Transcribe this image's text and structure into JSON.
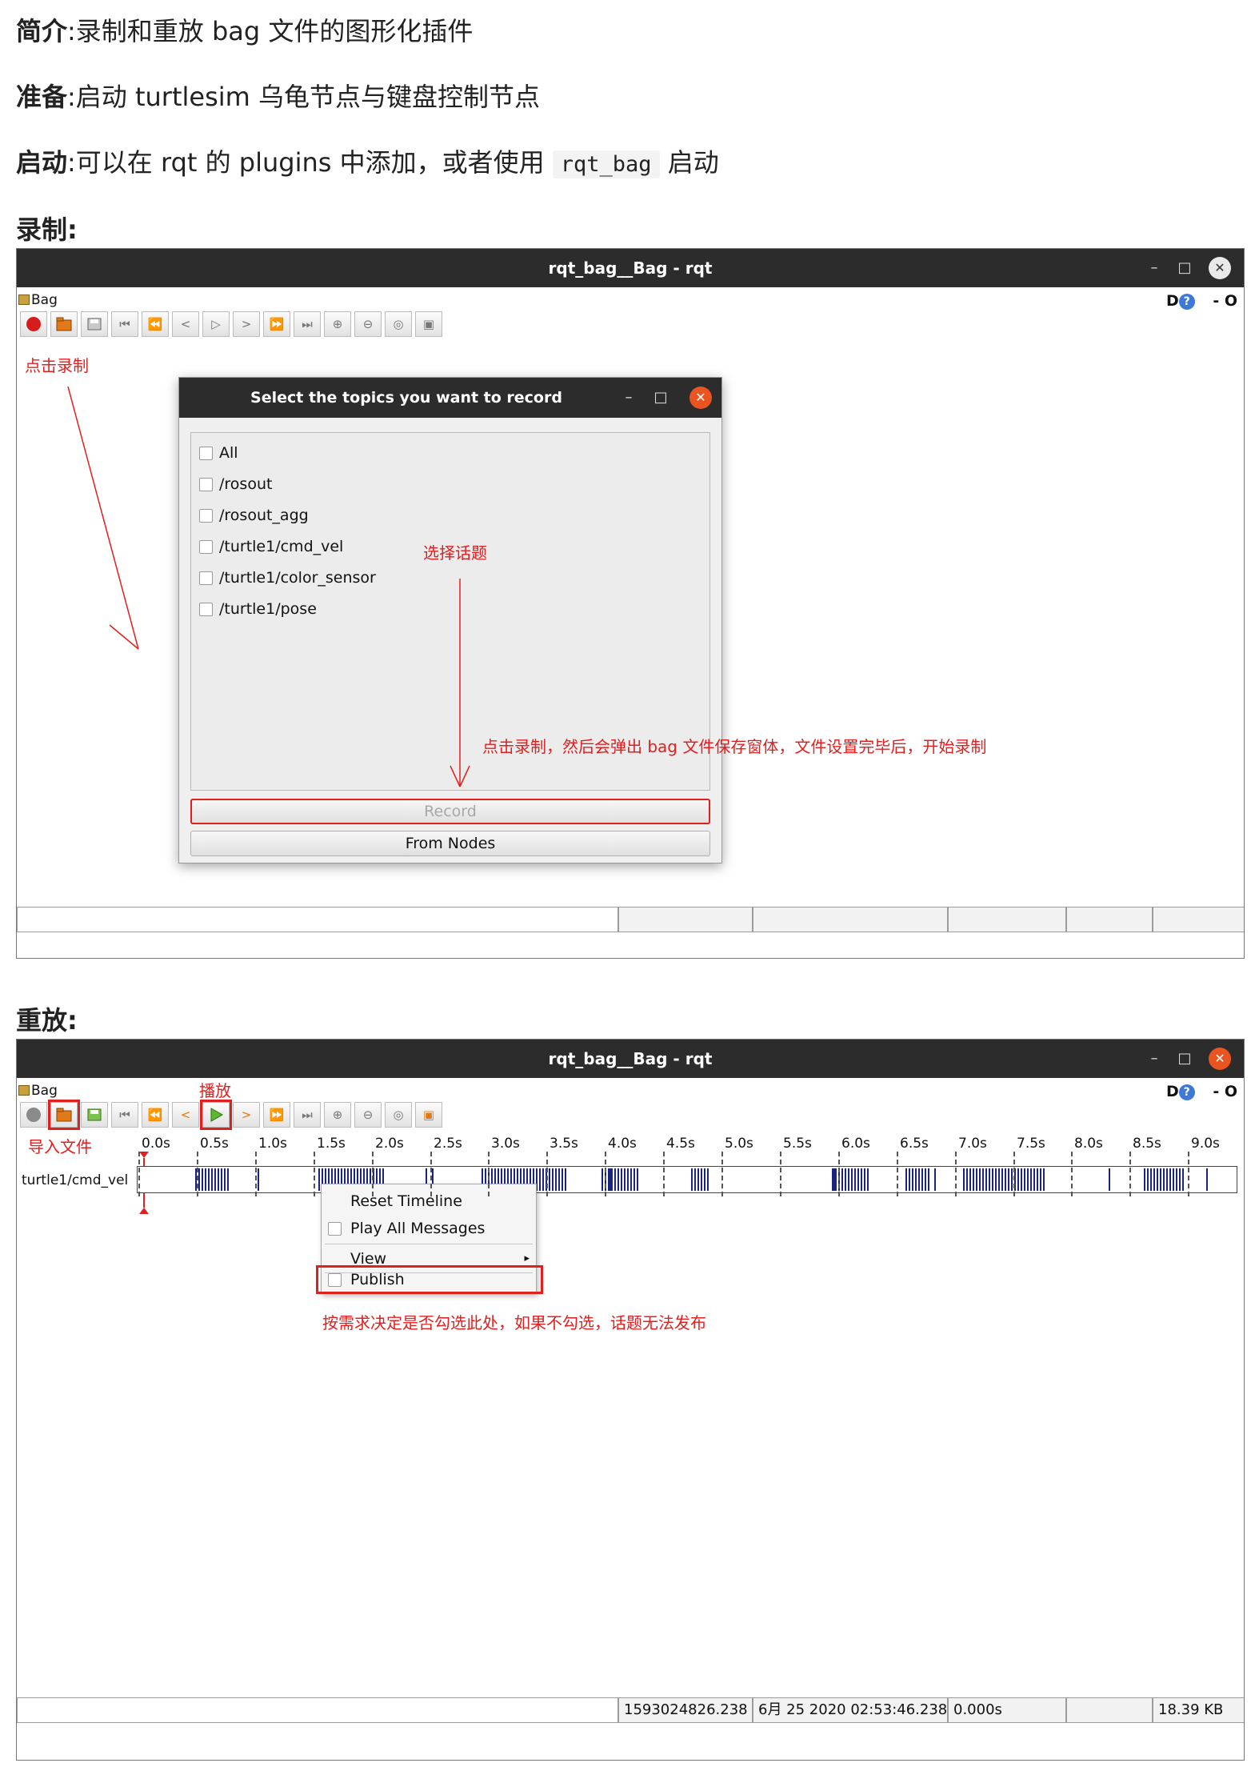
{
  "intro": {
    "label": "简介",
    "text": ":录制和重放 bag 文件的图形化插件"
  },
  "prep": {
    "label": "准备",
    "text": ":启动 turtlesim 乌龟节点与键盘控制节点"
  },
  "launch": {
    "label": "启动",
    "text_before": ":可以在 rqt 的 plugins 中添加，或者使用",
    "code": "rqt_bag",
    "text_after": "启动"
  },
  "record_heading": "录制:",
  "replay_heading": "重放:",
  "window": {
    "title": "rqt_bag__Bag - rqt",
    "menu_label": "Bag",
    "right_controls": "D",
    "help_icon": "?",
    "dash": "- O",
    "minimize": "–",
    "maximize": "□",
    "close": "✕"
  },
  "record_section": {
    "annotation_click_record": "点击录制",
    "annotation_select_topic": "选择话题",
    "annotation_after_record": "点击录制，然后会弹出 bag 文件保存窗体，文件设置完毕后，开始录制",
    "dialog": {
      "title": "Select the topics you want to record",
      "topics": [
        "All",
        "/rosout",
        "/rosout_agg",
        "/turtle1/cmd_vel",
        "/turtle1/color_sensor",
        "/turtle1/pose"
      ],
      "record_button": "Record",
      "from_nodes_button": "From Nodes"
    }
  },
  "replay_section": {
    "annotation_play": "播放",
    "annotation_import": "导入文件",
    "annotation_publish": "按需求决定是否勾选此处，如果不勾选，话题无法发布",
    "ticks": [
      "0.0s",
      "0.5s",
      "1.0s",
      "1.5s",
      "2.0s",
      "2.5s",
      "3.0s",
      "3.5s",
      "4.0s",
      "4.5s",
      "5.0s",
      "5.5s",
      "6.0s",
      "6.5s",
      "7.0s",
      "7.5s",
      "8.0s",
      "8.5s",
      "9.0s"
    ],
    "topic_name": "turtle1/cmd_vel",
    "context_menu": {
      "reset_timeline": "Reset Timeline",
      "play_all_messages": "Play All Messages",
      "view": "View",
      "publish": "Publish"
    },
    "status": {
      "timestamp": "1593024826.238",
      "datetime": "6月 25 2020 02:53:46.238",
      "elapsed": "0.000s",
      "size": "18.39 KB"
    }
  },
  "colors": {
    "accent_red": "#e02020",
    "titlebar": "#2c2c2c",
    "message_blue": "#1a237e",
    "close_orange": "#e95420"
  }
}
